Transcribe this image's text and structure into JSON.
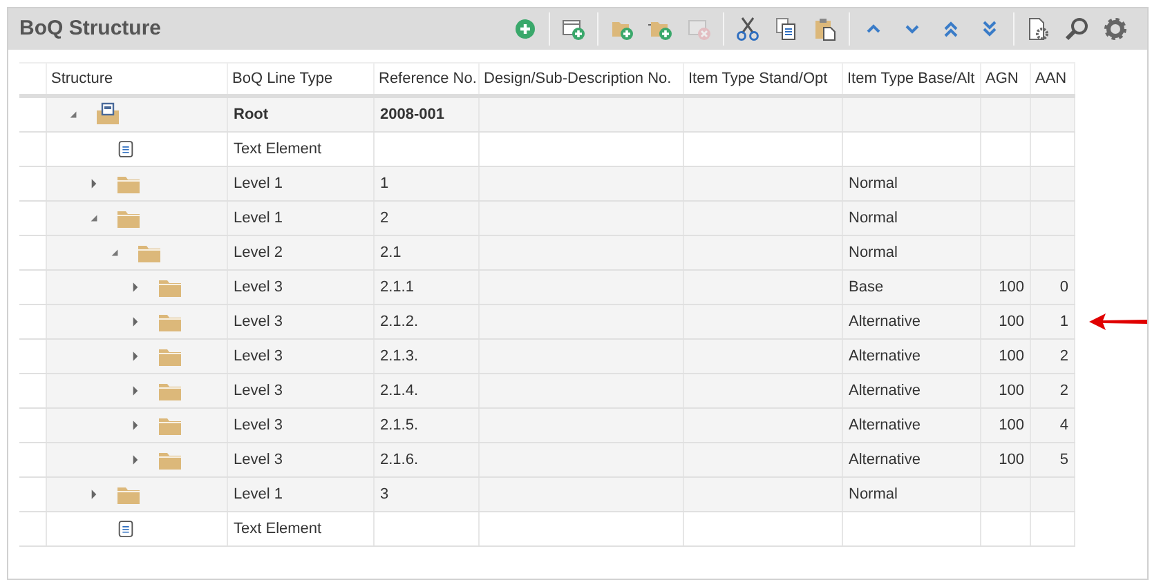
{
  "panel": {
    "title": "BoQ Structure"
  },
  "toolbar": [
    [
      {
        "kind": "add",
        "disabled": false
      }
    ],
    [
      {
        "kind": "new-folder",
        "disabled": false
      }
    ],
    [
      {
        "kind": "add-folder",
        "disabled": false
      },
      {
        "kind": "add-subfolder",
        "disabled": false
      },
      {
        "kind": "delete-folder",
        "disabled": true
      }
    ],
    [
      {
        "kind": "cut",
        "disabled": false
      },
      {
        "kind": "copy",
        "disabled": false
      },
      {
        "kind": "paste",
        "disabled": false
      }
    ],
    [
      {
        "kind": "up",
        "disabled": false
      },
      {
        "kind": "down",
        "disabled": false
      },
      {
        "kind": "top",
        "disabled": false
      },
      {
        "kind": "bottom",
        "disabled": false
      }
    ],
    [
      {
        "kind": "doc-settings",
        "disabled": false
      },
      {
        "kind": "search",
        "disabled": false
      },
      {
        "kind": "settings",
        "disabled": false
      }
    ]
  ],
  "table": {
    "columns": [
      "Structure",
      "BoQ Line Type",
      "Reference No.",
      "Design/Sub-Description No.",
      "Item Type Stand/Opt",
      "Item Type Base/Alt",
      "AGN",
      "AAN"
    ],
    "rows": [
      {
        "kind": "root",
        "expanded": true,
        "line_type": "Root",
        "reference": "2008-001",
        "pointer": false,
        "children": [
          {
            "kind": "text",
            "line_type": "Text Element",
            "pointer": false
          },
          {
            "kind": "folder",
            "expanded": false,
            "line_type": "Level 1",
            "reference": "1",
            "base_alt": "Normal",
            "pointer": false
          },
          {
            "kind": "folder",
            "expanded": true,
            "line_type": "Level 1",
            "reference": "2",
            "base_alt": "Normal",
            "pointer": false,
            "children": [
              {
                "kind": "folder",
                "expanded": true,
                "line_type": "Level 2",
                "reference": "2.1",
                "base_alt": "Normal",
                "pointer": false,
                "children": [
                  {
                    "kind": "folder",
                    "expanded": false,
                    "line_type": "Level 3",
                    "reference": "2.1.1",
                    "base_alt": "Base",
                    "agn": "100",
                    "aan": "0",
                    "pointer": false
                  },
                  {
                    "kind": "folder",
                    "expanded": false,
                    "line_type": "Level 3",
                    "reference": "2.1.2.",
                    "base_alt": "Alternative",
                    "agn": "100",
                    "aan": "1",
                    "pointer": true
                  },
                  {
                    "kind": "folder",
                    "expanded": false,
                    "line_type": "Level 3",
                    "reference": "2.1.3.",
                    "base_alt": "Alternative",
                    "agn": "100",
                    "aan": "2",
                    "pointer": false
                  },
                  {
                    "kind": "folder",
                    "expanded": false,
                    "line_type": "Level 3",
                    "reference": "2.1.4.",
                    "base_alt": "Alternative",
                    "agn": "100",
                    "aan": "2",
                    "pointer": false
                  },
                  {
                    "kind": "folder",
                    "expanded": false,
                    "line_type": "Level 3",
                    "reference": "2.1.5.",
                    "base_alt": "Alternative",
                    "agn": "100",
                    "aan": "4",
                    "pointer": false
                  },
                  {
                    "kind": "folder",
                    "expanded": false,
                    "line_type": "Level 3",
                    "reference": "2.1.6.",
                    "base_alt": "Alternative",
                    "agn": "100",
                    "aan": "5",
                    "pointer": false
                  }
                ]
              }
            ]
          },
          {
            "kind": "folder",
            "expanded": false,
            "line_type": "Level 1",
            "reference": "3",
            "base_alt": "Normal",
            "pointer": false
          },
          {
            "kind": "text",
            "line_type": "Text Element",
            "pointer": false
          }
        ]
      }
    ]
  }
}
